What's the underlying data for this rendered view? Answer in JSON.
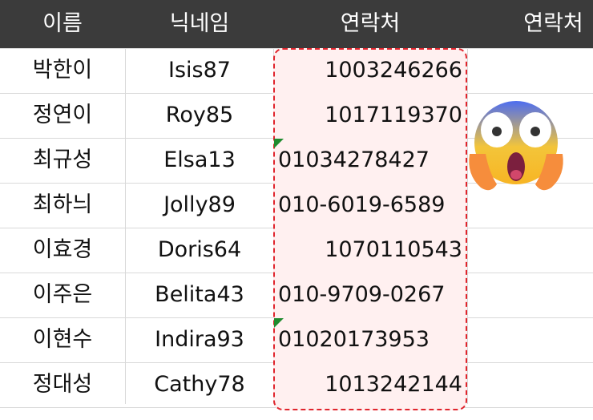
{
  "header": {
    "col_name": "이름",
    "col_nick": "닉네임",
    "col_contact": "연락처",
    "col_contact2": "연락처"
  },
  "rows": [
    {
      "name": "박한이",
      "nick": "Isis87",
      "contact": "1003246266",
      "align": "right",
      "text_flag": false
    },
    {
      "name": "정연이",
      "nick": "Roy85",
      "contact": "1017119370",
      "align": "right",
      "text_flag": false
    },
    {
      "name": "최규성",
      "nick": "Elsa13",
      "contact": "01034278427",
      "align": "left",
      "text_flag": true
    },
    {
      "name": "최하늬",
      "nick": "Jolly89",
      "contact": "010-6019-6589",
      "align": "left",
      "text_flag": false
    },
    {
      "name": "이효경",
      "nick": "Doris64",
      "contact": "1070110543",
      "align": "right",
      "text_flag": false
    },
    {
      "name": "이주은",
      "nick": "Belita43",
      "contact": "010-9709-0267",
      "align": "left",
      "text_flag": false
    },
    {
      "name": "이현수",
      "nick": "Indira93",
      "contact": "01020173953",
      "align": "left",
      "text_flag": true
    },
    {
      "name": "정대성",
      "nick": "Cathy78",
      "contact": "1013242144",
      "align": "right",
      "text_flag": false
    }
  ],
  "colors": {
    "header_bg": "#3b3b3b",
    "highlight_fill": "#fff0f0",
    "highlight_border": "#e0242c",
    "error_flag": "#1f8b2e"
  },
  "icons": {
    "emoji": "face-screaming-in-fear-icon"
  }
}
